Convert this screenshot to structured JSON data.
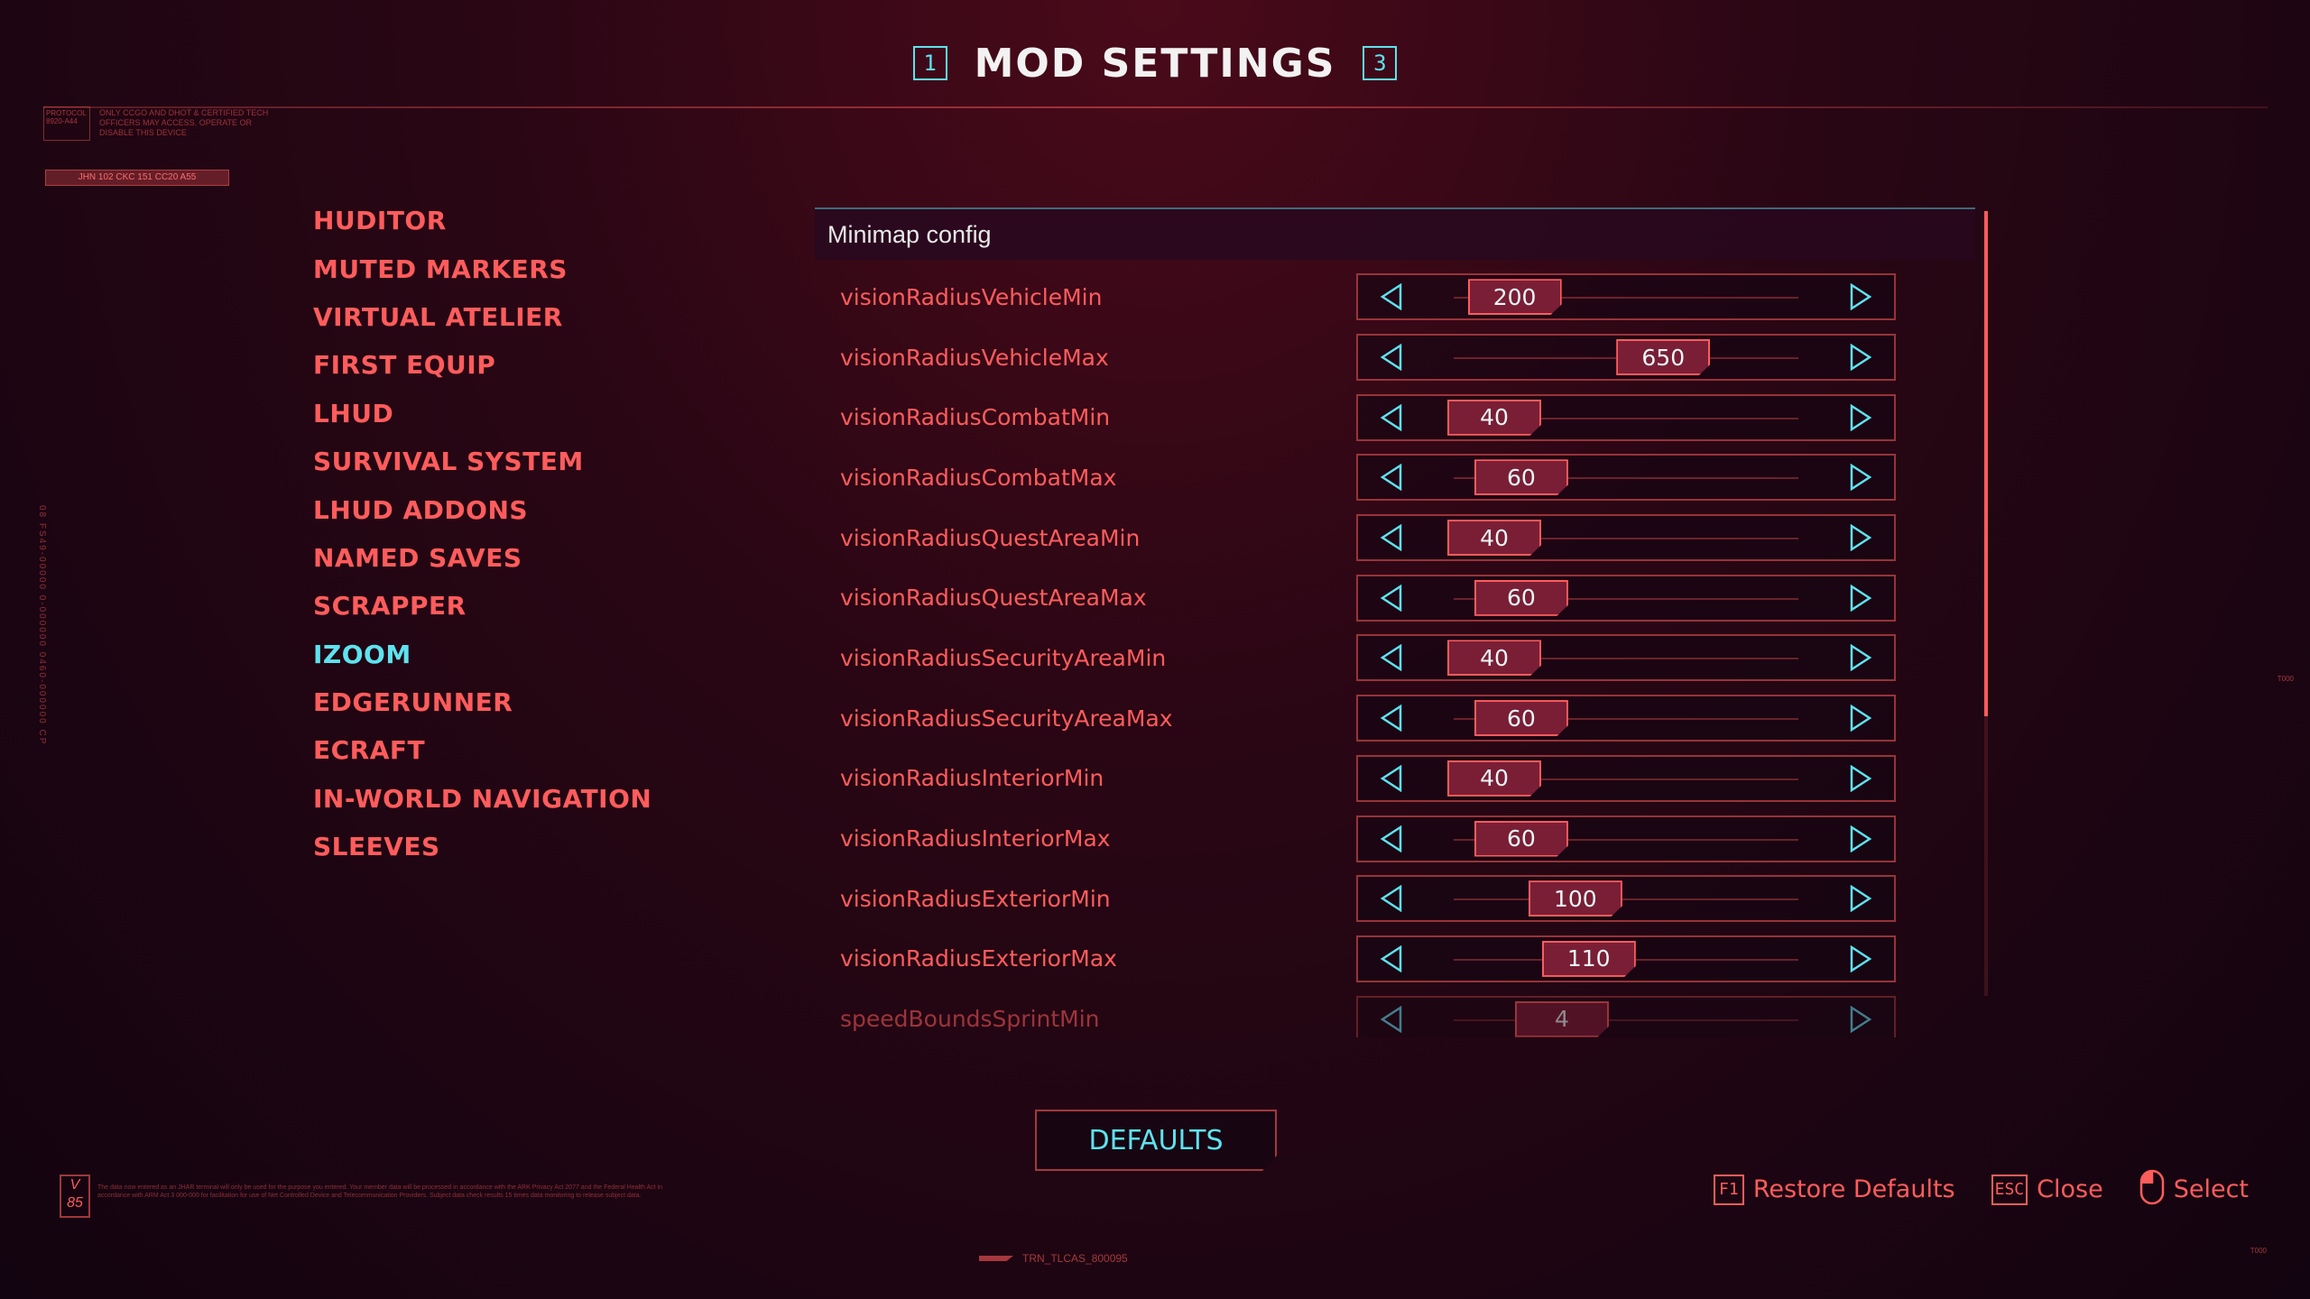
{
  "header": {
    "title": "MOD SETTINGS",
    "prev_key": "1",
    "next_key": "3"
  },
  "deco": {
    "logo_text": "PROTOCOL 8920-A44",
    "notice": "ONLY CCGO AND DHOT & CERTIFIED TECH OFFICERS MAY ACCESS. OPERATE OR DISABLE THIS DEVICE",
    "bar_text": "JHN 102 CKC 151 CC20 A55",
    "side_code": "08 FS49-00000 0-000000 0460-000000 CP"
  },
  "nav": {
    "items": [
      "HUDITOR",
      "MUTED MARKERS",
      "VIRTUAL ATELIER",
      "FIRST EQUIP",
      "LHUD",
      "SURVIVAL SYSTEM",
      "LHUD ADDONS",
      "NAMED SAVES",
      "SCRAPPER",
      "IZOOM",
      "EDGERUNNER",
      "ECRAFT",
      "IN-WORLD NAVIGATION",
      "SLEEVES"
    ],
    "active_index": 9
  },
  "section": {
    "title": "Minimap config"
  },
  "settings": [
    {
      "label": "visionRadiusVehicleMin",
      "value": "200",
      "fraction": 0.177
    },
    {
      "label": "visionRadiusVehicleMax",
      "value": "650",
      "fraction": 0.608
    },
    {
      "label": "visionRadiusCombatMin",
      "value": "40",
      "fraction": 0.118
    },
    {
      "label": "visionRadiusCombatMax",
      "value": "60",
      "fraction": 0.196
    },
    {
      "label": "visionRadiusQuestAreaMin",
      "value": "40",
      "fraction": 0.118
    },
    {
      "label": "visionRadiusQuestAreaMax",
      "value": "60",
      "fraction": 0.196
    },
    {
      "label": "visionRadiusSecurityAreaMin",
      "value": "40",
      "fraction": 0.118
    },
    {
      "label": "visionRadiusSecurityAreaMax",
      "value": "60",
      "fraction": 0.196
    },
    {
      "label": "visionRadiusInteriorMin",
      "value": "40",
      "fraction": 0.118
    },
    {
      "label": "visionRadiusInteriorMax",
      "value": "60",
      "fraction": 0.196
    },
    {
      "label": "visionRadiusExteriorMin",
      "value": "100",
      "fraction": 0.353
    },
    {
      "label": "visionRadiusExteriorMax",
      "value": "110",
      "fraction": 0.392
    },
    {
      "label": "speedBoundsSprintMin",
      "value": "4",
      "fraction": 0.314
    }
  ],
  "defaults_button": "DEFAULTS",
  "hints": [
    {
      "key": "F1",
      "label": "Restore Defaults"
    },
    {
      "key": "ESC",
      "label": "Close"
    },
    {
      "key": "mouse-icon",
      "label": "Select"
    }
  ],
  "version": "V 85",
  "fineprint": "The data now entered as an JHAR terminal will only be used for the purpose you entered. Your member data will be processed in accordance with the ARK Privacy Act 2077 and the Federal Health Act in accordance with ARM Act 3 000-000 for facilitation for use of Net Controlled Device and Telecommunication Providers. Subject data check results 15 times data monitoring to release subject data.",
  "bottom_code": "TRN_TLCAS_800095",
  "corner_mark": "T000",
  "side_mark": "T000",
  "colors": {
    "accent_cyan": "#5ee2ef",
    "primary_red": "#ff5c5c",
    "handle_fill": "#7a1e36"
  }
}
